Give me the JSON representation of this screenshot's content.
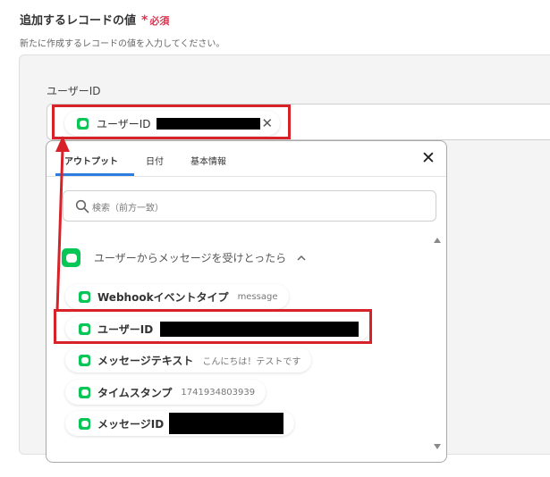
{
  "section": {
    "title": "追加するレコードの値",
    "required_mark": "*",
    "required_text": "必須",
    "description": "新たに作成するレコードの値を入力してください。"
  },
  "field": {
    "label": "ユーザーID",
    "chip_label": "ユーザーID"
  },
  "dropdown": {
    "tabs": [
      {
        "label": "アウトプット",
        "active": true
      },
      {
        "label": "日付",
        "active": false
      },
      {
        "label": "基本情報",
        "active": false
      }
    ],
    "search_placeholder": "検索（前方一致）",
    "group_title": "ユーザーからメッセージを受けとったら",
    "items": [
      {
        "label": "Webhookイベントタイプ",
        "sample": "message"
      },
      {
        "label": "ユーザーID",
        "sample": ""
      },
      {
        "label": "メッセージテキスト",
        "sample": "こんにちは！テストです"
      },
      {
        "label": "タイムスタンプ",
        "sample": "1741934803939"
      },
      {
        "label": "メッセージID",
        "sample": ""
      }
    ]
  },
  "icons": {
    "service": "line-icon",
    "close": "close-icon",
    "search": "search-icon",
    "chevron": "chevron-up-icon"
  },
  "colors": {
    "accent_red": "#d8222a",
    "required_red": "#e0334f",
    "line_green": "#06c755",
    "tab_active_blue": "#2d7de0"
  }
}
